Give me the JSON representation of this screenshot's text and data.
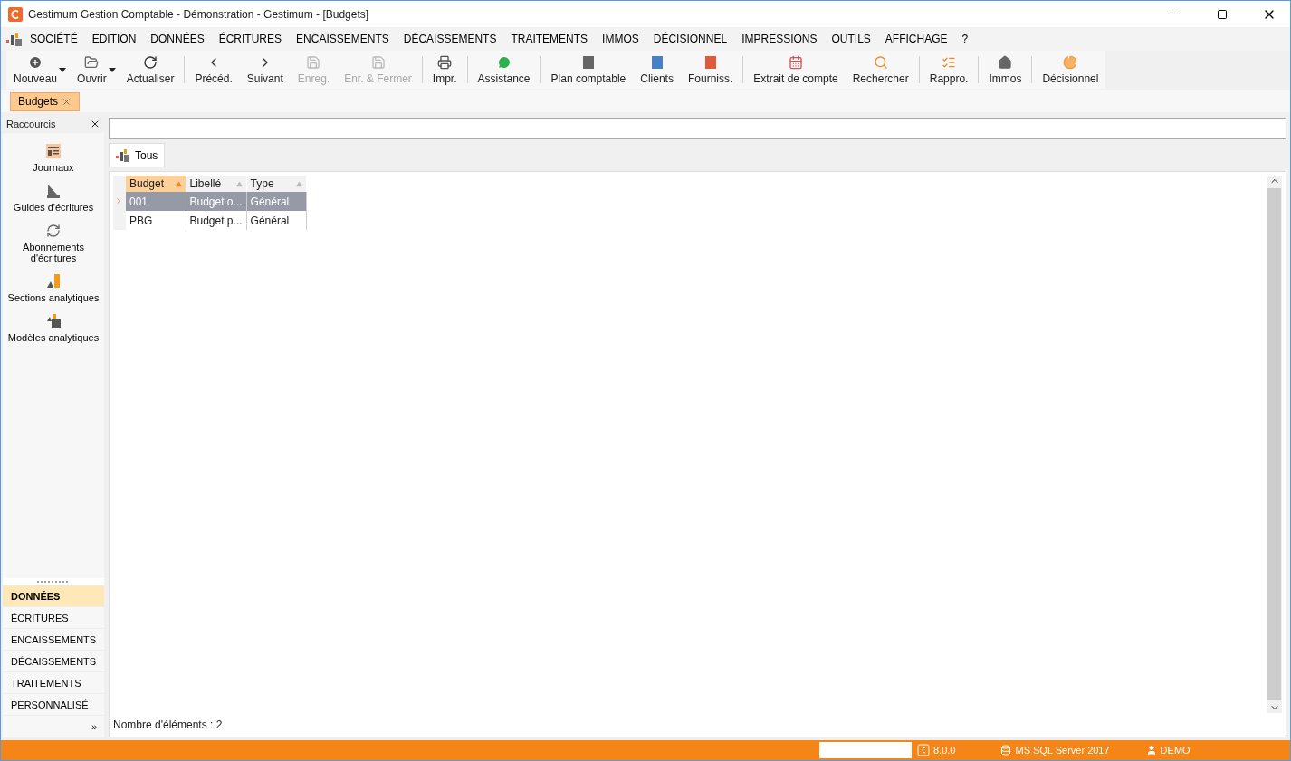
{
  "window": {
    "title": "Gestimum Gestion Comptable - Démonstration - Gestimum - [Budgets]"
  },
  "menu": [
    "SOCIÉTÉ",
    "EDITION",
    "DONNÉES",
    "ÉCRITURES",
    "ENCAISSEMENTS",
    "DÉCAISSEMENTS",
    "TRAITEMENTS",
    "IMMOS",
    "DÉCISIONNEL",
    "IMPRESSIONS",
    "OUTILS",
    "AFFICHAGE",
    "?"
  ],
  "toolbar_groups": [
    [
      {
        "label": "Nouveau",
        "disabled": false,
        "dropdown": true
      },
      {
        "label": "Ouvrir",
        "disabled": false,
        "dropdown": true
      },
      {
        "label": "Actualiser",
        "disabled": false,
        "dropdown": false
      }
    ],
    [
      {
        "label": "Précéd.",
        "disabled": false,
        "dropdown": false
      },
      {
        "label": "Suivant",
        "disabled": false,
        "dropdown": false
      },
      {
        "label": "Enreg.",
        "disabled": true,
        "dropdown": false
      },
      {
        "label": "Enr. & Fermer",
        "disabled": true,
        "dropdown": false
      }
    ],
    [
      {
        "label": "Impr.",
        "disabled": false,
        "dropdown": false
      }
    ],
    [
      {
        "label": "Assistance",
        "disabled": false,
        "dropdown": false
      }
    ],
    [
      {
        "label": "Plan comptable",
        "disabled": false,
        "dropdown": false
      },
      {
        "label": "Clients",
        "disabled": false,
        "dropdown": false
      },
      {
        "label": "Fourniss.",
        "disabled": false,
        "dropdown": false
      }
    ],
    [
      {
        "label": "Extrait de compte",
        "disabled": false,
        "dropdown": false
      },
      {
        "label": "Rechercher",
        "disabled": false,
        "dropdown": false
      }
    ],
    [
      {
        "label": "Rappro.",
        "disabled": false,
        "dropdown": false
      }
    ],
    [
      {
        "label": "Immos",
        "disabled": false,
        "dropdown": false
      }
    ],
    [
      {
        "label": "Décisionnel",
        "disabled": false,
        "dropdown": false
      }
    ]
  ],
  "doc_tabs": [
    {
      "label": "Budgets",
      "selected": true
    }
  ],
  "sidebar": {
    "title": "Raccourcis",
    "shortcuts": [
      "Journaux",
      "Guides d'écritures",
      "Abonnements d'écritures",
      "Sections analytiques",
      "Modèles analytiques"
    ],
    "sections": [
      {
        "label": "DONNÉES",
        "selected": true
      },
      {
        "label": "ÉCRITURES",
        "selected": false
      },
      {
        "label": "ENCAISSEMENTS",
        "selected": false
      },
      {
        "label": "DÉCAISSEMENTS",
        "selected": false
      },
      {
        "label": "TRAITEMENTS",
        "selected": false
      },
      {
        "label": "PERSONNALISÉ",
        "selected": false
      }
    ],
    "more": "»"
  },
  "view_tabs": [
    {
      "label": "Tous",
      "selected": true
    }
  ],
  "table": {
    "columns": [
      {
        "label": "Budget",
        "sorted": true
      },
      {
        "label": "Libellé",
        "sorted": false
      },
      {
        "label": "Type",
        "sorted": false
      }
    ],
    "rows": [
      {
        "cells": [
          "001",
          "Budget o...",
          "Général"
        ],
        "selected": true
      },
      {
        "cells": [
          "PBG",
          "Budget p...",
          "Général"
        ],
        "selected": false
      }
    ]
  },
  "footer": "Nombre d'éléments : 2",
  "status_bar": {
    "version": "8.0.0",
    "server": "MS SQL Server 2017",
    "user": "DEMO"
  }
}
